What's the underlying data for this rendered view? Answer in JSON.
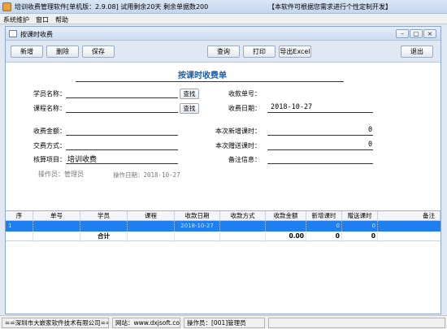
{
  "app": {
    "title": "培训收费管理软件[单机版：2.9.08]  试用剩余20天  剩余单据数200",
    "slogan": "【本软件可根据您需求进行个性定制开发】"
  },
  "menu": {
    "items": [
      "系统维护",
      "窗口",
      "帮助"
    ]
  },
  "window": {
    "title": "按课时收费",
    "min": "–",
    "restore": "▢",
    "close": "×"
  },
  "toolbar": {
    "add": "新增",
    "delete": "删除",
    "save": "保存",
    "query": "查询",
    "print": "打印",
    "export": "导出Excel",
    "exit": "退出"
  },
  "form": {
    "heading": "按课时收费单",
    "student_label": "学员名称：",
    "student_value": "",
    "course_label": "课程名称：",
    "course_value": "",
    "find_label": "查找",
    "receipt_no_label": "收款单号：",
    "receipt_no_value": "",
    "receipt_date_label": "收费日期：",
    "receipt_date_value": "2018-10-27",
    "amount_label": "收费金额：",
    "amount_value": "",
    "pay_method_label": "交费方式：",
    "pay_method_value": "",
    "account_label": "核算项目：",
    "account_value": "培训收费",
    "new_hours_label": "本次新增课时：",
    "new_hours_value": "0",
    "gift_hours_label": "本次赠送课时：",
    "gift_hours_value": "0",
    "remark_label": "备注信息：",
    "remark_value": "",
    "operator_label": "操作员：管理员",
    "op_date_label": "操作日期：2018-10-27"
  },
  "grid": {
    "headers": [
      "序",
      "单号",
      "学员",
      "课程",
      "收款日期",
      "收款方式",
      "收款金额",
      "新增课时",
      "赠送课时",
      "备注"
    ],
    "row1": {
      "seq": "1",
      "date": "2018-10-27",
      "new_hours": "0",
      "gift_hours": "0"
    },
    "total": {
      "label": "合计",
      "amount": "0.00",
      "new_hours": "0",
      "gift_hours": "0"
    }
  },
  "status": {
    "company": "==深圳市大嵌家软件技术有限公司==",
    "website": "网站：www.dxjsoft.com",
    "operator": "操作员：[001]管理员"
  },
  "colors": {
    "selection": "#1e7ff0",
    "accent": "#1e5fa8"
  }
}
